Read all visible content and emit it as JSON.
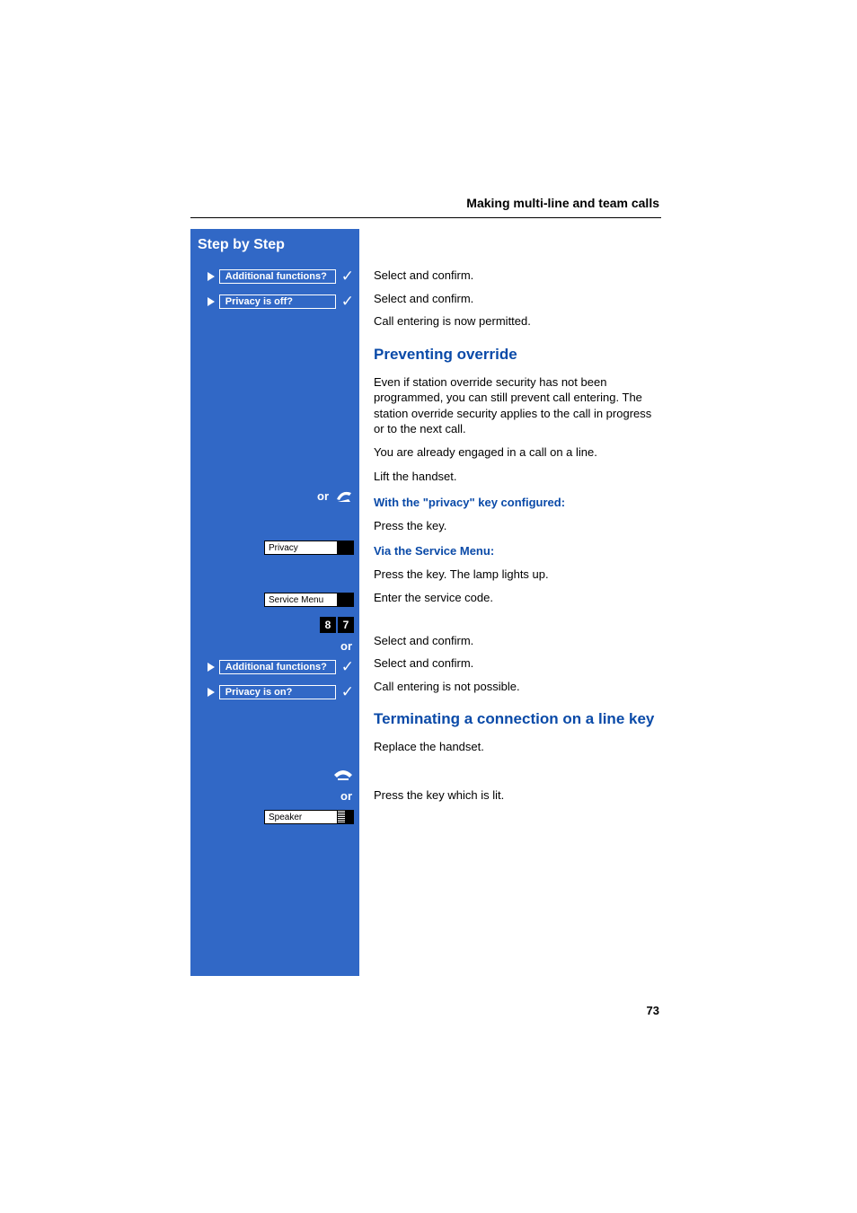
{
  "header": "Making multi-line and team calls",
  "sidebar_title": "Step by Step",
  "page_number": "73",
  "labels": {
    "or": "or",
    "additional_functions": "Additional functions?",
    "privacy_off": "Privacy is off?",
    "privacy_on": "Privacy is on?",
    "privacy_key": "Privacy",
    "service_menu": "Service Menu",
    "speaker": "Speaker",
    "digit8": "8",
    "digit7": "7"
  },
  "main": {
    "p1": "Select and confirm.",
    "p2": "Select and confirm.",
    "p3": "Call entering is now permitted.",
    "h_prevent": "Preventing override",
    "p4": "Even if station override security has not been programmed, you can still prevent call entering. The station override security applies to the call in progress or to the next call.",
    "p5": "You are already engaged in a call on a line.",
    "p6": "Lift the handset.",
    "h_privkey": "With the \"privacy\" key configured:",
    "p7": "Press the key.",
    "h_service": "Via the Service Menu:",
    "p8": "Press the key. The lamp lights up.",
    "p9": "Enter the service code.",
    "p10": "Select and confirm.",
    "p11": "Select and confirm.",
    "p12": "Call entering is not possible.",
    "h_terminate": "Terminating a connection on a line key",
    "p13": "Replace the handset.",
    "p14": "Press the key which is lit."
  }
}
